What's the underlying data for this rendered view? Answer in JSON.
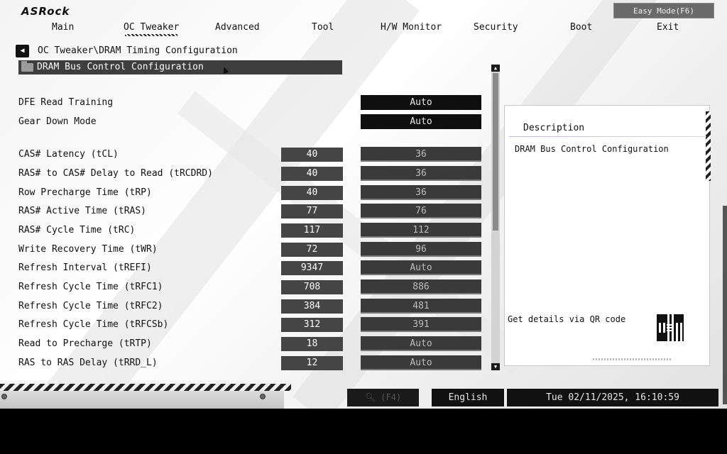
{
  "brand": {
    "logo": "ASRock"
  },
  "header": {
    "easy_mode": "Easy Mode(F6)"
  },
  "tabs": [
    {
      "label": "Main",
      "active": false
    },
    {
      "label": "OC Tweaker",
      "active": true
    },
    {
      "label": "Advanced",
      "active": false
    },
    {
      "label": "Tool",
      "active": false
    },
    {
      "label": "H/W Monitor",
      "active": false
    },
    {
      "label": "Security",
      "active": false
    },
    {
      "label": "Boot",
      "active": false
    },
    {
      "label": "Exit",
      "active": false
    }
  ],
  "breadcrumb": "OC Tweaker\\DRAM Timing Configuration",
  "submenu": {
    "label": "DRAM Bus Control Configuration"
  },
  "options": [
    {
      "label": "DFE Read Training",
      "current": "",
      "setting": "Auto"
    },
    {
      "label": "Gear Down Mode",
      "current": "",
      "setting": "Auto"
    },
    {
      "label": "CAS# Latency (tCL)",
      "current": "40",
      "setting": "36"
    },
    {
      "label": "RAS# to CAS# Delay to Read  (tRCDRD)",
      "current": "40",
      "setting": "36"
    },
    {
      "label": "Row Precharge Time (tRP)",
      "current": "40",
      "setting": "36"
    },
    {
      "label": "RAS# Active Time (tRAS)",
      "current": "77",
      "setting": "76"
    },
    {
      "label": "RAS# Cycle Time (tRC)",
      "current": "117",
      "setting": "112"
    },
    {
      "label": "Write Recovery Time (tWR)",
      "current": "72",
      "setting": "96"
    },
    {
      "label": "Refresh Interval (tREFI)",
      "current": "9347",
      "setting": "Auto"
    },
    {
      "label": "Refresh Cycle Time (tRFC1)",
      "current": "708",
      "setting": "886"
    },
    {
      "label": "Refresh Cycle Time (tRFC2)",
      "current": "384",
      "setting": "481"
    },
    {
      "label": "Refresh Cycle Time (tRFCSb)",
      "current": "312",
      "setting": "391"
    },
    {
      "label": "Read to Precharge (tRTP)",
      "current": "18",
      "setting": "Auto"
    },
    {
      "label": "RAS to RAS Delay (tRRD_L)",
      "current": "12",
      "setting": "Auto"
    }
  ],
  "description": {
    "title": "Description",
    "text": "DRAM Bus Control Configuration",
    "qr_hint": "Get details via QR code"
  },
  "footer": {
    "search": "(F4)",
    "language": "English",
    "datetime": "Tue 02/11/2025, 16:10:59"
  },
  "colors": {
    "panel_dark": "#0f0f0f",
    "value_box": "#454545",
    "setting_box": "#3a3a3a",
    "background": "#f4f4f4"
  }
}
